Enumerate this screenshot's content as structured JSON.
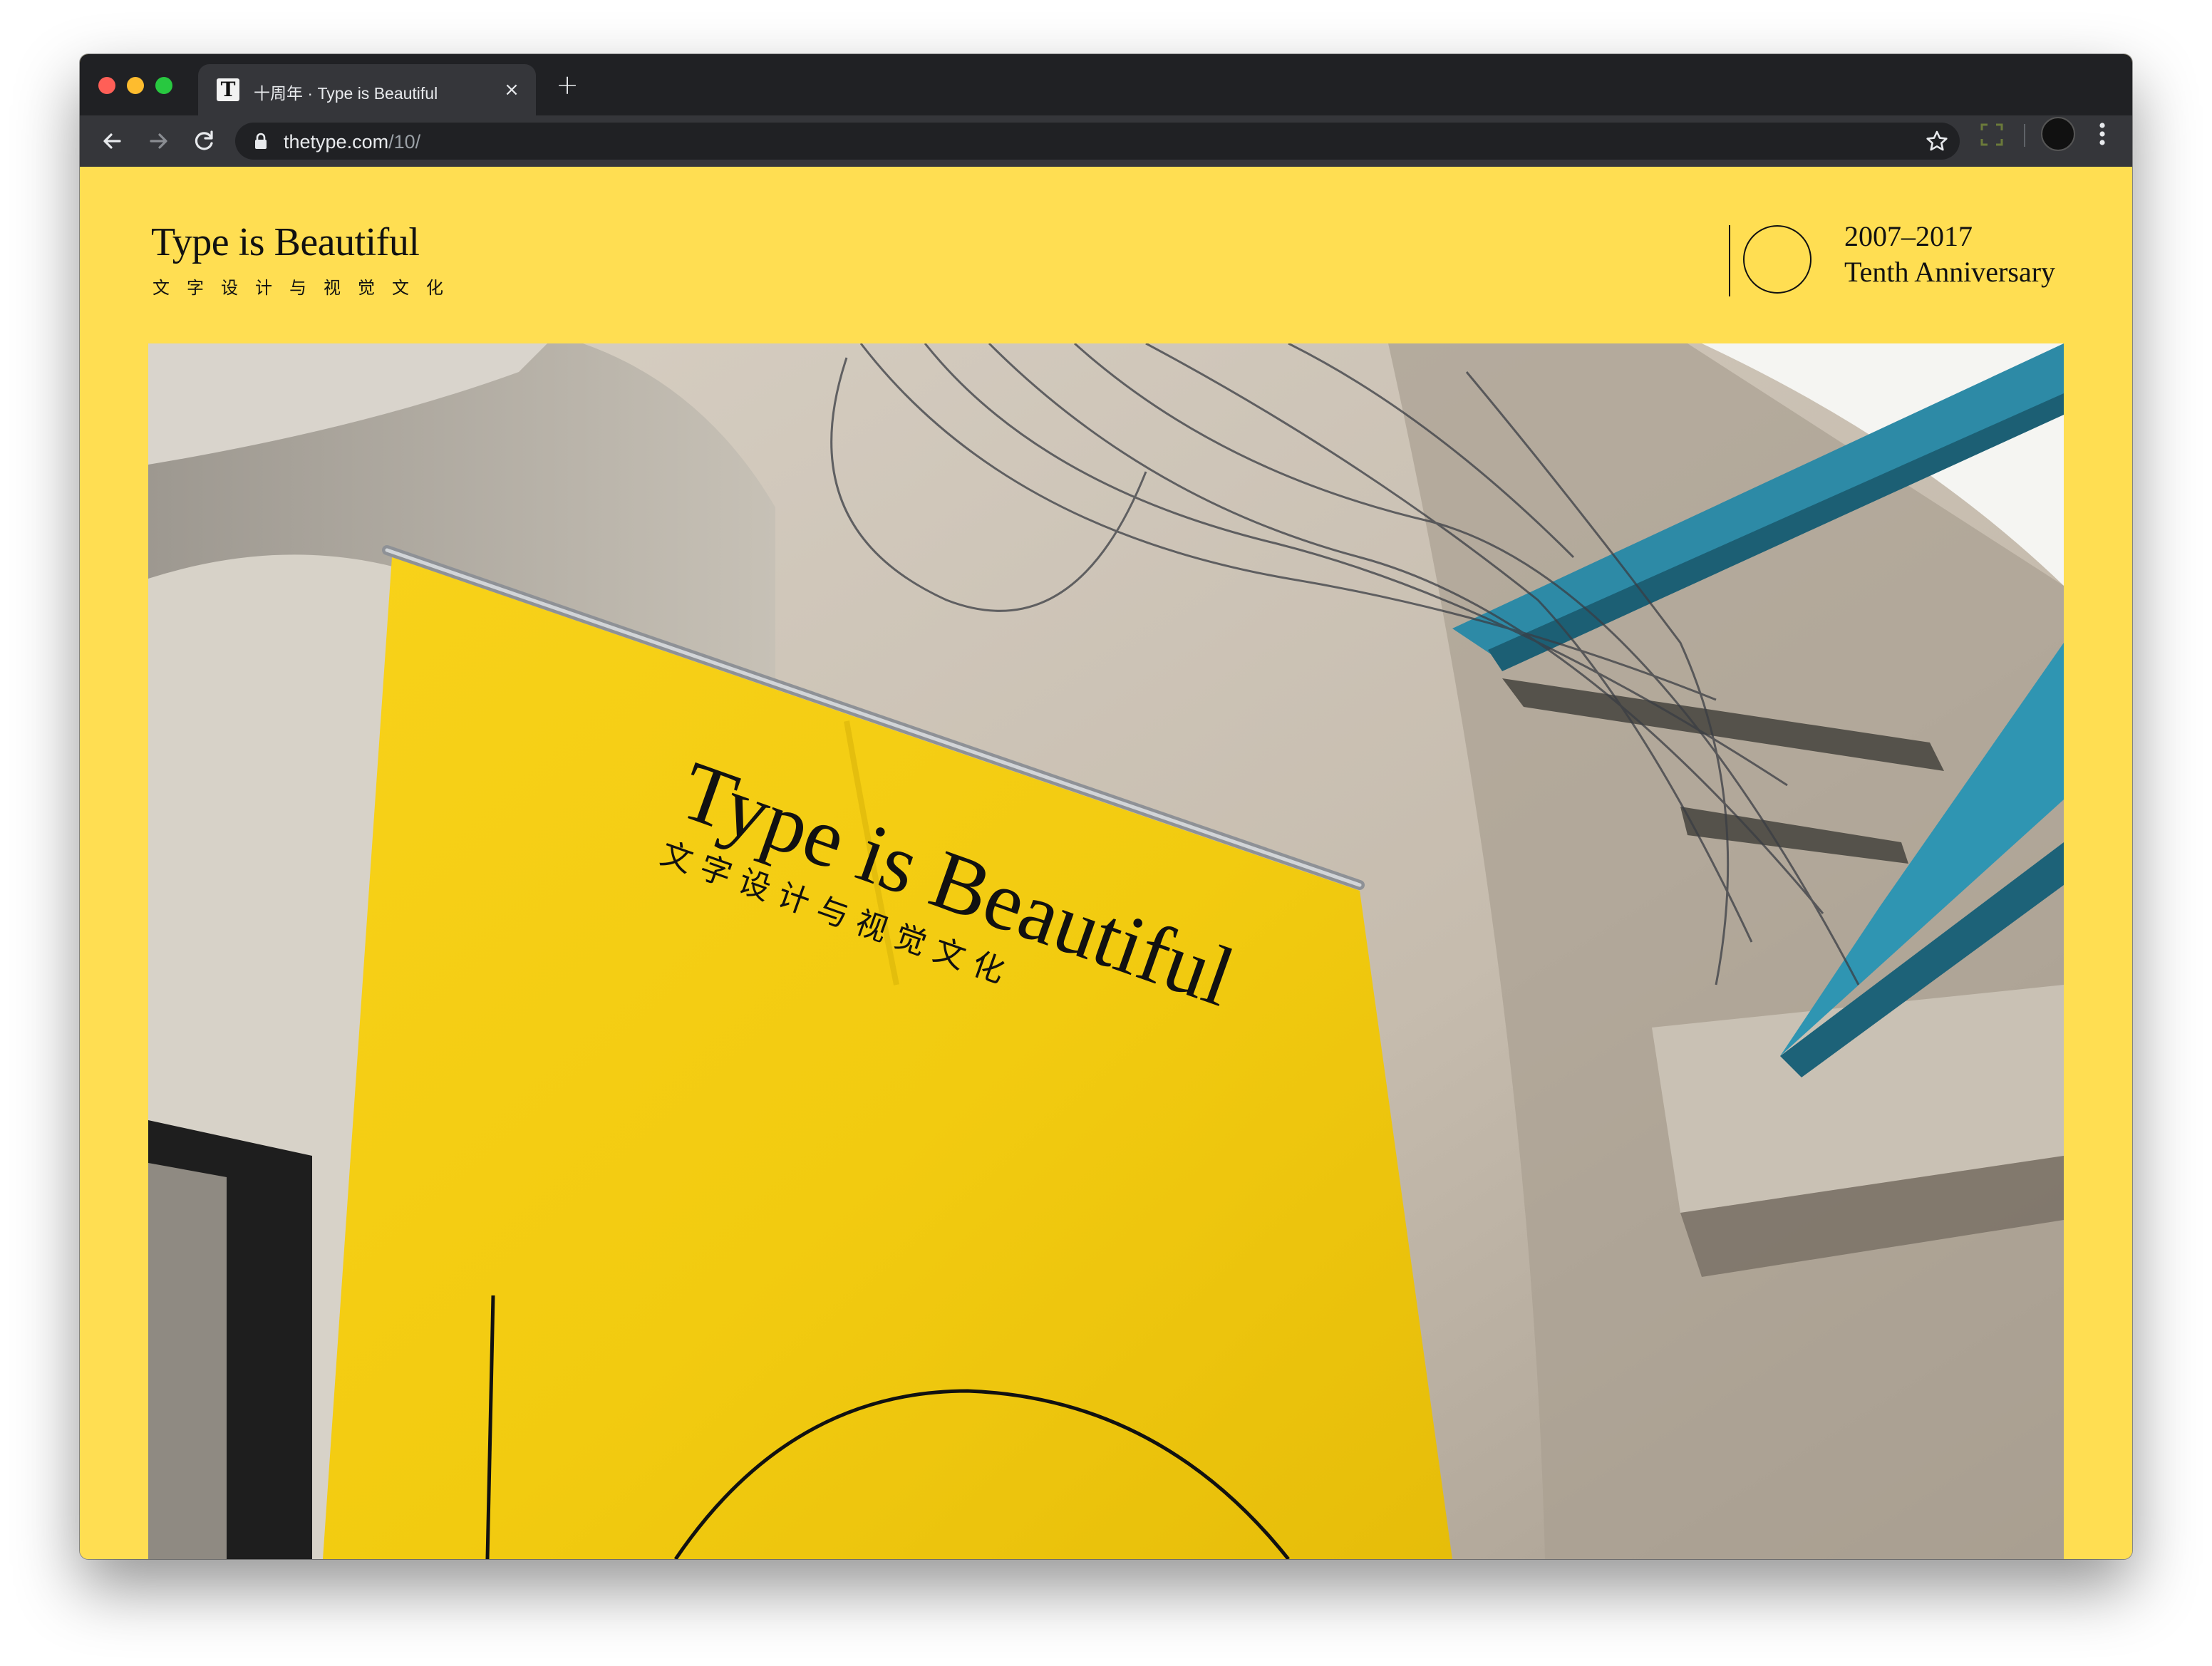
{
  "browser": {
    "tab": {
      "favicon": "T",
      "title": "十周年 · Type is Beautiful",
      "close_icon": "×"
    },
    "new_tab_icon": "+",
    "address": {
      "host": "thetype.com",
      "path": "/10/"
    }
  },
  "site": {
    "title": "Type is Beautiful",
    "subtitle": "文字设计与视觉文化",
    "anniversary": {
      "years": "2007–2017",
      "label": "Tenth Anniversary"
    }
  },
  "photo": {
    "banner_title": "Type is Beautiful",
    "banner_subtitle": "文 字 设 计 与 视 觉 文 化"
  },
  "colors": {
    "page_background": "#ffde52",
    "browser_frame": "#202124",
    "toolbar": "#35363a"
  }
}
